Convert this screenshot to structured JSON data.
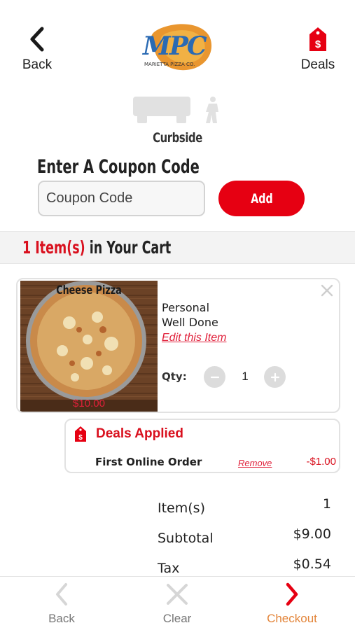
{
  "header": {
    "back_label": "Back",
    "deals_label": "Deals",
    "logo_text": "MPC",
    "logo_subtext": "MARIETTA PIZZA CO."
  },
  "order_type": {
    "label": "Curbside"
  },
  "coupon": {
    "title": "Enter A Coupon Code",
    "placeholder": "Coupon Code",
    "value": "",
    "add_label": "Add"
  },
  "cart": {
    "count_prefix": "1 Item(s)",
    "count_suffix": " in Your Cart",
    "items": [
      {
        "name": "Cheese Pizza",
        "price": "$10.00",
        "option_size": "Personal",
        "option_bake": "Well Done",
        "edit_label": "Edit this Item",
        "qty_label": "Qty:",
        "qty_value": "1"
      }
    ]
  },
  "deals": {
    "title": "Deals Applied",
    "items": [
      {
        "name": "First Online Order",
        "remove_label": "Remove",
        "amount": "-$1.00"
      }
    ]
  },
  "summary": {
    "rows": [
      {
        "label": "Item(s)",
        "value": "1"
      },
      {
        "label": "Subtotal",
        "value": "$9.00"
      },
      {
        "label": "Tax",
        "value": "$0.54"
      }
    ]
  },
  "bottom_nav": {
    "back_label": "Back",
    "clear_label": "Clear",
    "checkout_label": "Checkout"
  },
  "colors": {
    "brand_red": "#e60012",
    "checkout_orange": "#e3853a",
    "disabled_gray": "#cfcfcf"
  },
  "icons": {
    "back": "chevron-left-icon",
    "deals": "price-tag-icon",
    "remove_item": "close-icon",
    "qty_minus": "minus-icon",
    "qty_plus": "plus-icon",
    "clear": "close-icon",
    "checkout": "chevron-right-icon"
  }
}
